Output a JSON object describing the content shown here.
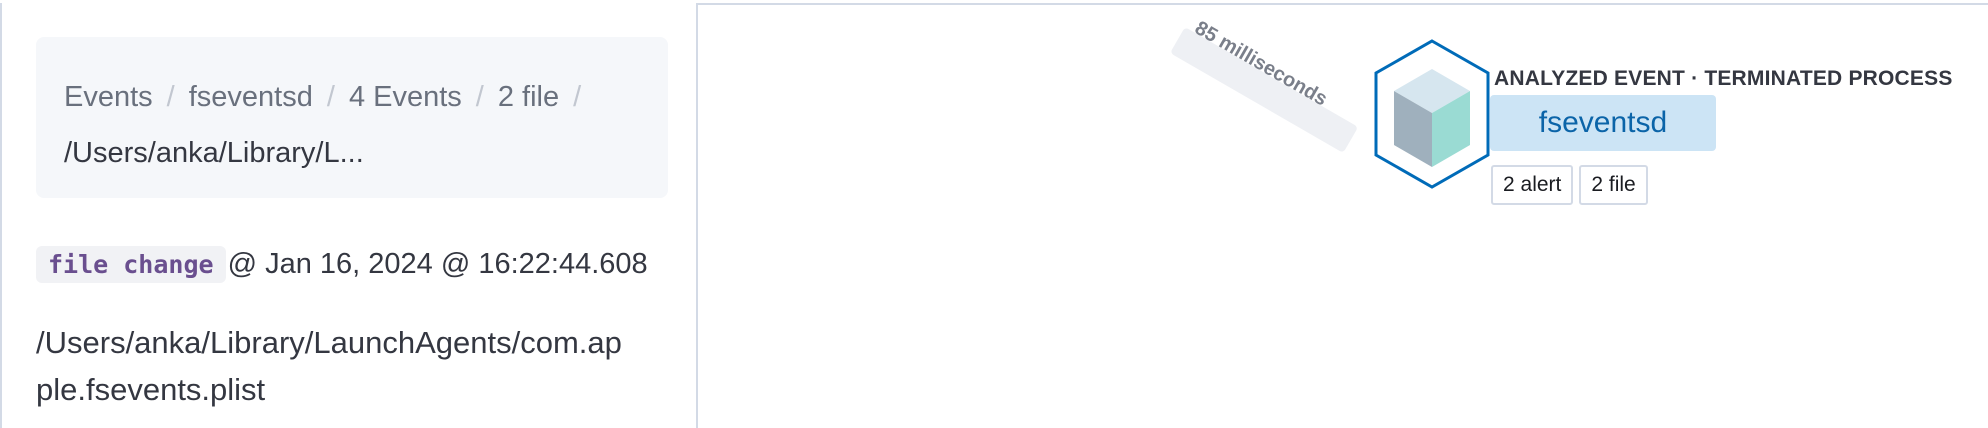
{
  "breadcrumbs": {
    "items": [
      "Events",
      "fseventsd",
      "4 Events",
      "2 file"
    ],
    "current": "/Users/anka/Library/L...",
    "separator": "/"
  },
  "event": {
    "type_tag": "file change",
    "timestamp": "@ Jan 16, 2024 @ 16:22:44.608",
    "file_path": "/Users/anka/Library/LaunchAgents/com.apple.fsevents.plist"
  },
  "graph": {
    "edge_label": "85 milliseconds",
    "node": {
      "title": "ANALYZED EVENT · TERMINATED PROCESS",
      "name": "fseventsd",
      "icon": "cube-icon",
      "badges": [
        "2 alert",
        "2 file"
      ]
    },
    "colors": {
      "accent": "#006bb8",
      "name_bg": "#cce4f5",
      "cube_left": "#9fb0bd",
      "cube_right": "#9adbd3"
    }
  }
}
